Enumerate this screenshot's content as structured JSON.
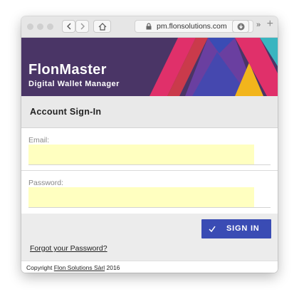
{
  "browser": {
    "url": "pm.flonsolutions.com",
    "icons": [
      "back-icon",
      "forward-icon",
      "home-icon",
      "lock-icon",
      "reload-icon",
      "download-icon",
      "chevron-right-icon",
      "plus-icon"
    ],
    "more_glyph": "»",
    "new_tab_glyph": "+"
  },
  "banner": {
    "title": "FlonMaster",
    "subtitle": "Digital Wallet Manager",
    "colors": {
      "background": "#4a3566",
      "magenta": "#e0306a",
      "red": "#d83b48",
      "purple": "#6a3fa0",
      "blue": "#3a4cb4",
      "yellow": "#f2b51c",
      "teal": "#39b5c0"
    }
  },
  "form": {
    "heading": "Account Sign-In",
    "email_label": "Email:",
    "email_value": "",
    "password_label": "Password:",
    "password_value": "",
    "signin_label": "SIGN IN",
    "signin_icon": "check-icon",
    "forgot_link": "Forgot your Password?"
  },
  "footer": {
    "prefix": "Copyright",
    "company": "Flon Solutions Sàrl",
    "year": "2016"
  },
  "colors": {
    "input_fill": "#ffffc0",
    "button": "#3a4cb4"
  }
}
